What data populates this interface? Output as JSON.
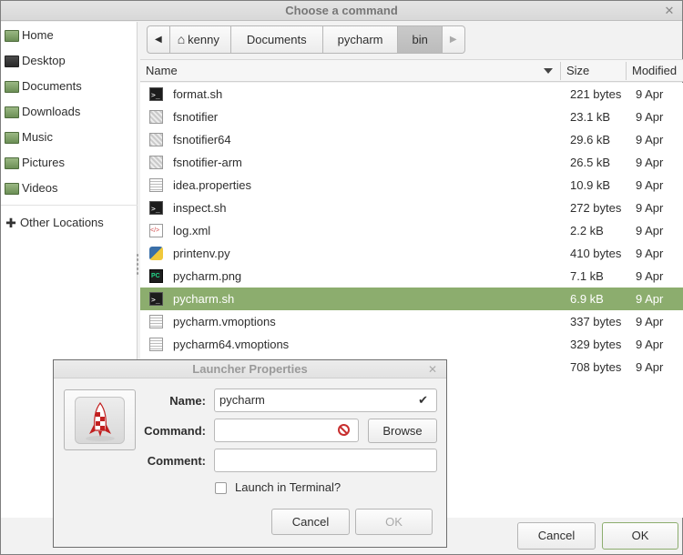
{
  "window": {
    "title": "Choose a command",
    "close_glyph": "✕"
  },
  "sidebar": {
    "items": [
      {
        "label": "Home",
        "icon": "home-folder-icon"
      },
      {
        "label": "Desktop",
        "icon": "desktop-icon"
      },
      {
        "label": "Documents",
        "icon": "folder-icon"
      },
      {
        "label": "Downloads",
        "icon": "folder-icon"
      },
      {
        "label": "Music",
        "icon": "folder-icon"
      },
      {
        "label": "Pictures",
        "icon": "folder-icon"
      },
      {
        "label": "Videos",
        "icon": "folder-icon"
      },
      {
        "label": "Other Locations",
        "icon": "plus-icon"
      }
    ]
  },
  "pathbar": {
    "back_glyph": "◀",
    "forward_glyph": "▶",
    "home_glyph": "⌂",
    "crumbs": [
      "kenny",
      "Documents",
      "pycharm",
      "bin"
    ]
  },
  "filelist": {
    "headers": {
      "name": "Name",
      "size": "Size",
      "modified": "Modified"
    },
    "rows": [
      {
        "name": "format.sh",
        "size": "221 bytes",
        "modified": "9 Apr",
        "icon": "terminal-icon"
      },
      {
        "name": "fsnotifier",
        "size": "23.1 kB",
        "modified": "9 Apr",
        "icon": "binary-icon"
      },
      {
        "name": "fsnotifier64",
        "size": "29.6 kB",
        "modified": "9 Apr",
        "icon": "binary-icon"
      },
      {
        "name": "fsnotifier-arm",
        "size": "26.5 kB",
        "modified": "9 Apr",
        "icon": "binary-icon"
      },
      {
        "name": "idea.properties",
        "size": "10.9 kB",
        "modified": "9 Apr",
        "icon": "text-file-icon"
      },
      {
        "name": "inspect.sh",
        "size": "272 bytes",
        "modified": "9 Apr",
        "icon": "terminal-icon"
      },
      {
        "name": "log.xml",
        "size": "2.2 kB",
        "modified": "9 Apr",
        "icon": "xml-file-icon"
      },
      {
        "name": "printenv.py",
        "size": "410 bytes",
        "modified": "9 Apr",
        "icon": "python-icon"
      },
      {
        "name": "pycharm.png",
        "size": "7.1 kB",
        "modified": "9 Apr",
        "icon": "pycharm-image-icon"
      },
      {
        "name": "pycharm.sh",
        "size": "6.9 kB",
        "modified": "9 Apr",
        "icon": "terminal-icon",
        "selected": true
      },
      {
        "name": "pycharm.vmoptions",
        "size": "337 bytes",
        "modified": "9 Apr",
        "icon": "text-file-icon"
      },
      {
        "name": "pycharm64.vmoptions",
        "size": "329 bytes",
        "modified": "9 Apr",
        "icon": "text-file-icon"
      },
      {
        "name": "",
        "size": "708 bytes",
        "modified": "9 Apr",
        "icon": ""
      }
    ]
  },
  "buttons": {
    "cancel": "Cancel",
    "ok": "OK"
  },
  "launcher": {
    "title": "Launcher Properties",
    "close_glyph": "✕",
    "name_label": "Name:",
    "name_value": "pycharm",
    "command_label": "Command:",
    "command_value": "",
    "browse": "Browse",
    "comment_label": "Comment:",
    "comment_value": "",
    "terminal_label": "Launch in Terminal?",
    "cancel": "Cancel",
    "ok": "OK",
    "icon": "rocket-icon"
  },
  "colors": {
    "selection": "#8cad6e",
    "accent": "#8cad6e"
  }
}
